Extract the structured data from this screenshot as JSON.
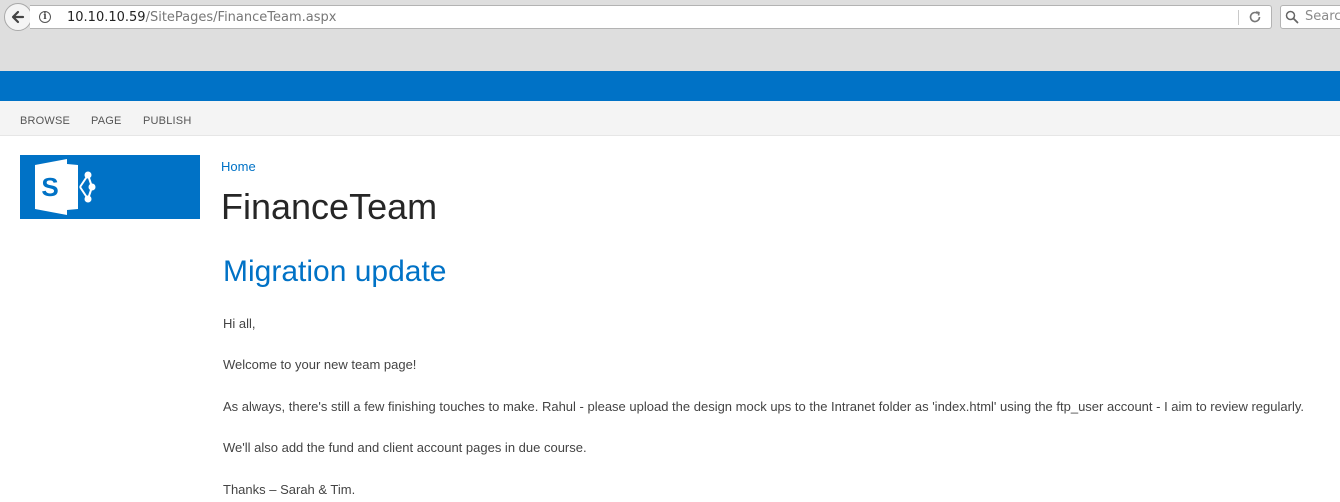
{
  "browser": {
    "url_host": "10.10.10.59",
    "url_path": "/SitePages/FinanceTeam.aspx",
    "search_placeholder": "Search"
  },
  "ribbon": {
    "tabs": [
      "BROWSE",
      "PAGE",
      "PUBLISH"
    ]
  },
  "site": {
    "logo_letter": "S",
    "breadcrumb": "Home",
    "title": "FinanceTeam"
  },
  "article": {
    "heading": "Migration update",
    "paragraphs": [
      "Hi all,",
      "Welcome to your new team page!",
      "As always, there's still a few finishing touches to make.  Rahul - please upload the design mock ups to the Intranet folder as 'index.html' using the ftp_user account - I aim to review regularly.",
      "We'll also add the fund and client account pages in due course.",
      "Thanks – Sarah & Tim."
    ]
  },
  "colors": {
    "accent": "#0072c6",
    "title_text": "#262626",
    "body_text": "#444444"
  }
}
